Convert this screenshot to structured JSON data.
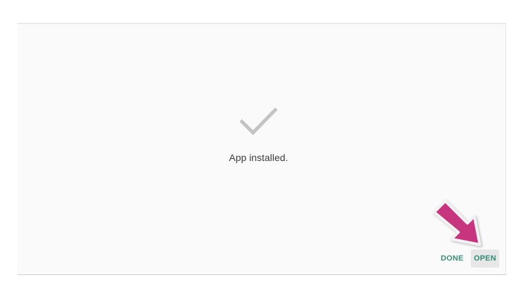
{
  "dialog": {
    "status_text": "App installed.",
    "icons": {
      "status": "checkmark-icon",
      "annotation": "arrow-pointer-icon"
    },
    "actions": {
      "done_label": "DONE",
      "open_label": "OPEN"
    }
  },
  "colors": {
    "accent": "#2f8a74",
    "checkmark": "#c3c3c3",
    "annotation_arrow": "#c8347f"
  }
}
